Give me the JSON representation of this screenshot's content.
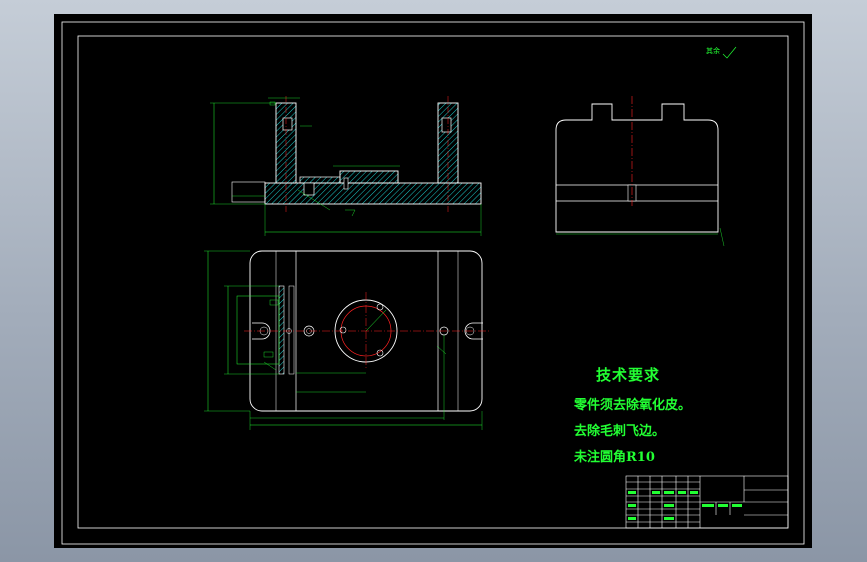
{
  "technical_requirements": {
    "title": "技术要求",
    "items": [
      "零件须去除氧化皮。",
      "去除毛刺飞边。",
      "未注圆角R10"
    ]
  },
  "surface_finish_note": "其余",
  "colors": {
    "background": "#000000",
    "frame": "#ffffff",
    "annotation": "#22ff33",
    "centerline": "#ff2222",
    "hatch": "#22ffff",
    "window_gradient_top": "#c5cdd7",
    "window_gradient_bottom": "#8b96a6"
  }
}
